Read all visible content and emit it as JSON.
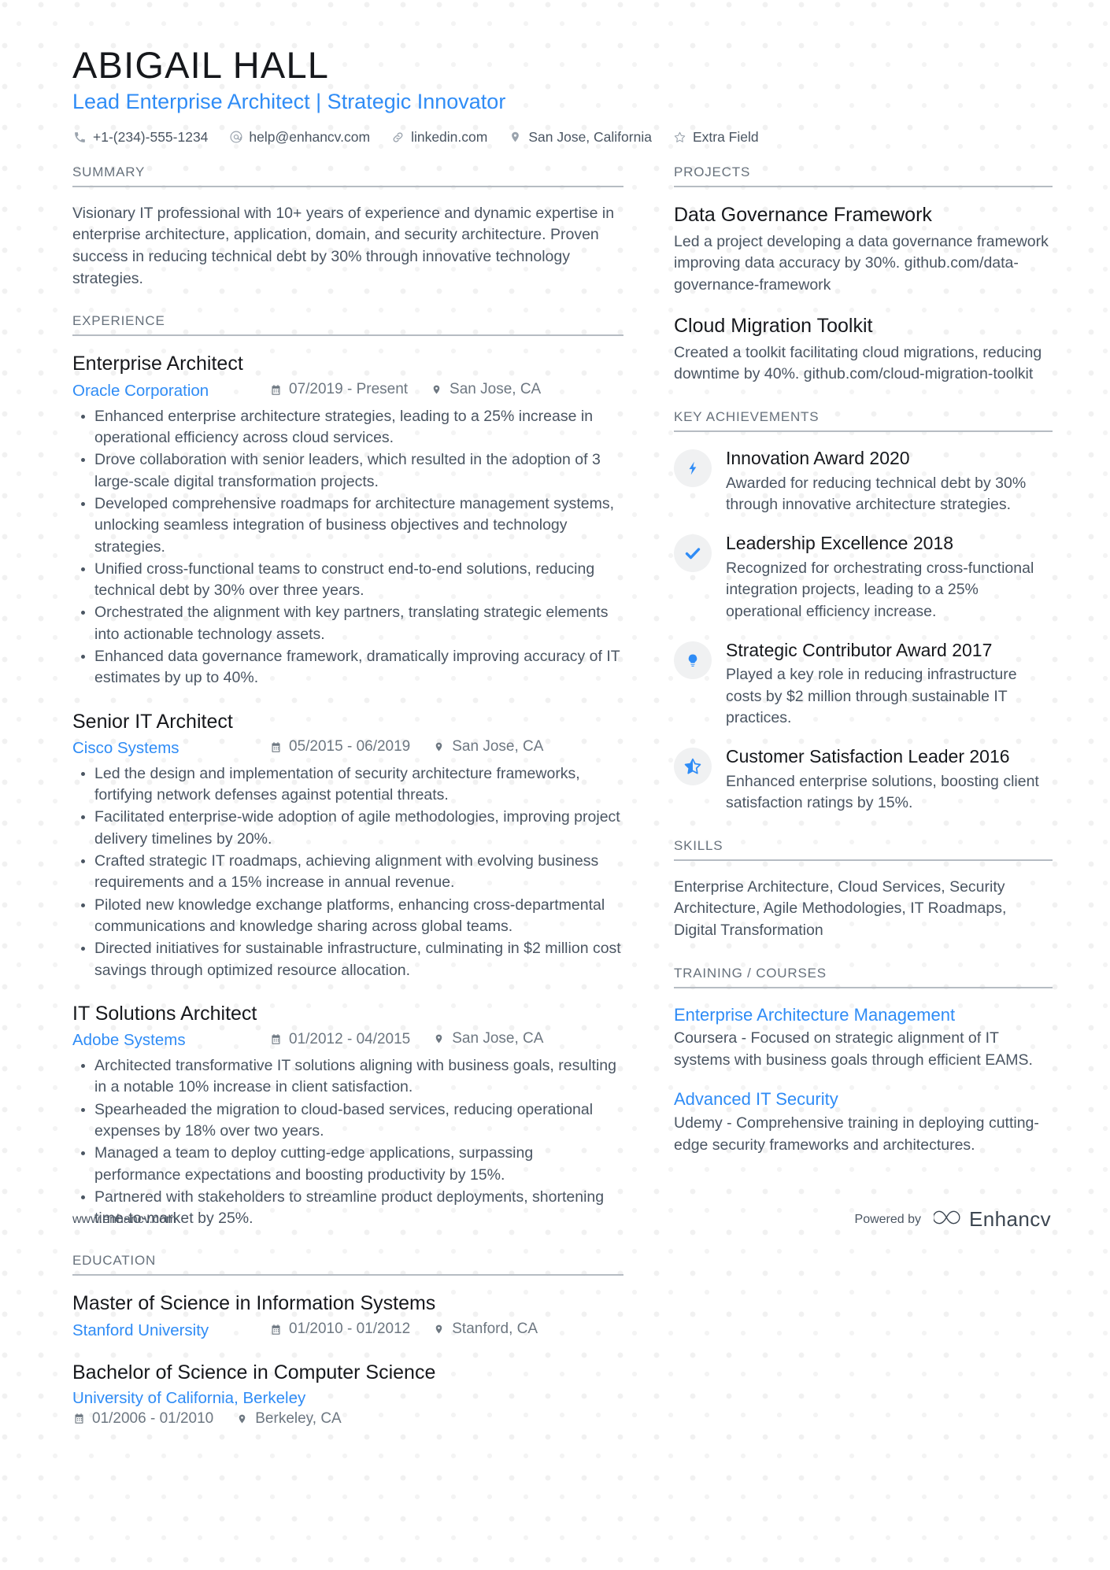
{
  "header": {
    "name": "ABIGAIL HALL",
    "headline": "Lead Enterprise Architect | Strategic Innovator",
    "contacts": [
      {
        "icon": "phone-icon",
        "text": "+1-(234)-555-1234"
      },
      {
        "icon": "email-icon",
        "text": "help@enhancv.com"
      },
      {
        "icon": "link-icon",
        "text": "linkedin.com"
      },
      {
        "icon": "location-icon",
        "text": "San Jose, California"
      },
      {
        "icon": "star-icon",
        "text": "Extra Field"
      }
    ]
  },
  "summary": {
    "heading": "SUMMARY",
    "text": "Visionary IT professional with 10+ years of experience and dynamic expertise in enterprise architecture, application, domain, and security architecture. Proven success in reducing technical debt by 30% through innovative technology strategies."
  },
  "experience": {
    "heading": "EXPERIENCE",
    "entries": [
      {
        "title": "Enterprise Architect",
        "org": "Oracle Corporation",
        "dates": "07/2019 - Present",
        "location": "San Jose, CA",
        "bullets": [
          "Enhanced enterprise architecture strategies, leading to a 25% increase in operational efficiency across cloud services.",
          "Drove collaboration with senior leaders, which resulted in the adoption of 3 large-scale digital transformation projects.",
          "Developed comprehensive roadmaps for architecture management systems, unlocking seamless integration of business objectives and technology strategies.",
          "Unified cross-functional teams to construct end-to-end solutions, reducing technical debt by 30% over three years.",
          "Orchestrated the alignment with key partners, translating strategic elements into actionable technology assets.",
          "Enhanced data governance framework, dramatically improving accuracy of IT estimates by up to 40%."
        ]
      },
      {
        "title": "Senior IT Architect",
        "org": "Cisco Systems",
        "dates": "05/2015 - 06/2019",
        "location": "San Jose, CA",
        "bullets": [
          "Led the design and implementation of security architecture frameworks, fortifying network defenses against potential threats.",
          "Facilitated enterprise-wide adoption of agile methodologies, improving project delivery timelines by 20%.",
          "Crafted strategic IT roadmaps, achieving alignment with evolving business requirements and a 15% increase in annual revenue.",
          "Piloted new knowledge exchange platforms, enhancing cross-departmental communications and knowledge sharing across global teams.",
          "Directed initiatives for sustainable infrastructure, culminating in $2 million cost savings through optimized resource allocation."
        ]
      },
      {
        "title": "IT Solutions Architect",
        "org": "Adobe Systems",
        "dates": "01/2012 - 04/2015",
        "location": "San Jose, CA",
        "bullets": [
          "Architected transformative IT solutions aligning with business goals, resulting in a notable 10% increase in client satisfaction.",
          "Spearheaded the migration to cloud-based services, reducing operational expenses by 18% over two years.",
          "Managed a team to deploy cutting-edge applications, surpassing performance expectations and boosting productivity by 15%.",
          "Partnered with stakeholders to streamline product deployments, shortening time-to-market by 25%."
        ]
      }
    ]
  },
  "education": {
    "heading": "EDUCATION",
    "entries": [
      {
        "title": "Master of Science in Information Systems",
        "org": "Stanford University",
        "dates": "01/2010 - 01/2012",
        "location": "Stanford, CA",
        "meta_wrapped": false
      },
      {
        "title": "Bachelor of Science in Computer Science",
        "org": "University of California, Berkeley",
        "dates": "01/2006 - 01/2010",
        "location": "Berkeley, CA",
        "meta_wrapped": true
      }
    ]
  },
  "projects": {
    "heading": "PROJECTS",
    "entries": [
      {
        "title": "Data Governance Framework",
        "desc": "Led a project developing a data governance framework improving data accuracy by 30%. github.com/data-governance-framework"
      },
      {
        "title": "Cloud Migration Toolkit",
        "desc": "Created a toolkit facilitating cloud migrations, reducing downtime by 40%. github.com/cloud-migration-toolkit"
      }
    ]
  },
  "achievements": {
    "heading": "KEY ACHIEVEMENTS",
    "entries": [
      {
        "icon": "lightning-bolt-icon",
        "title": "Innovation Award 2020",
        "desc": "Awarded for reducing technical debt by 30% through innovative architecture strategies."
      },
      {
        "icon": "check-icon",
        "title": "Leadership Excellence 2018",
        "desc": "Recognized for orchestrating cross-functional integration projects, leading to a 25% operational efficiency increase."
      },
      {
        "icon": "lightbulb-icon",
        "title": "Strategic Contributor Award 2017",
        "desc": "Played a key role in reducing infrastructure costs by $2 million through sustainable IT practices."
      },
      {
        "icon": "star-half-icon",
        "title": "Customer Satisfaction Leader 2016",
        "desc": "Enhanced enterprise solutions, boosting client satisfaction ratings by 15%."
      }
    ]
  },
  "skills": {
    "heading": "SKILLS",
    "text": "Enterprise Architecture, Cloud Services, Security Architecture, Agile Methodologies, IT Roadmaps, Digital Transformation"
  },
  "training": {
    "heading": "TRAINING / COURSES",
    "entries": [
      {
        "title": "Enterprise Architecture Management",
        "desc": "Coursera - Focused on strategic alignment of IT systems with business goals through efficient EAMS."
      },
      {
        "title": "Advanced IT Security",
        "desc": "Udemy - Comprehensive training in deploying cutting-edge security frameworks and architectures."
      }
    ]
  },
  "footer": {
    "website": "www.enhancv.com",
    "powered_by": "Powered by",
    "brand": "Enhancv"
  },
  "colors": {
    "accent": "#2f8cf6",
    "heading": "#16181c",
    "body": "#4a5562",
    "muted": "#67717c",
    "rule": "#b6bcc3",
    "badge_bg": "#f0f1f2"
  }
}
